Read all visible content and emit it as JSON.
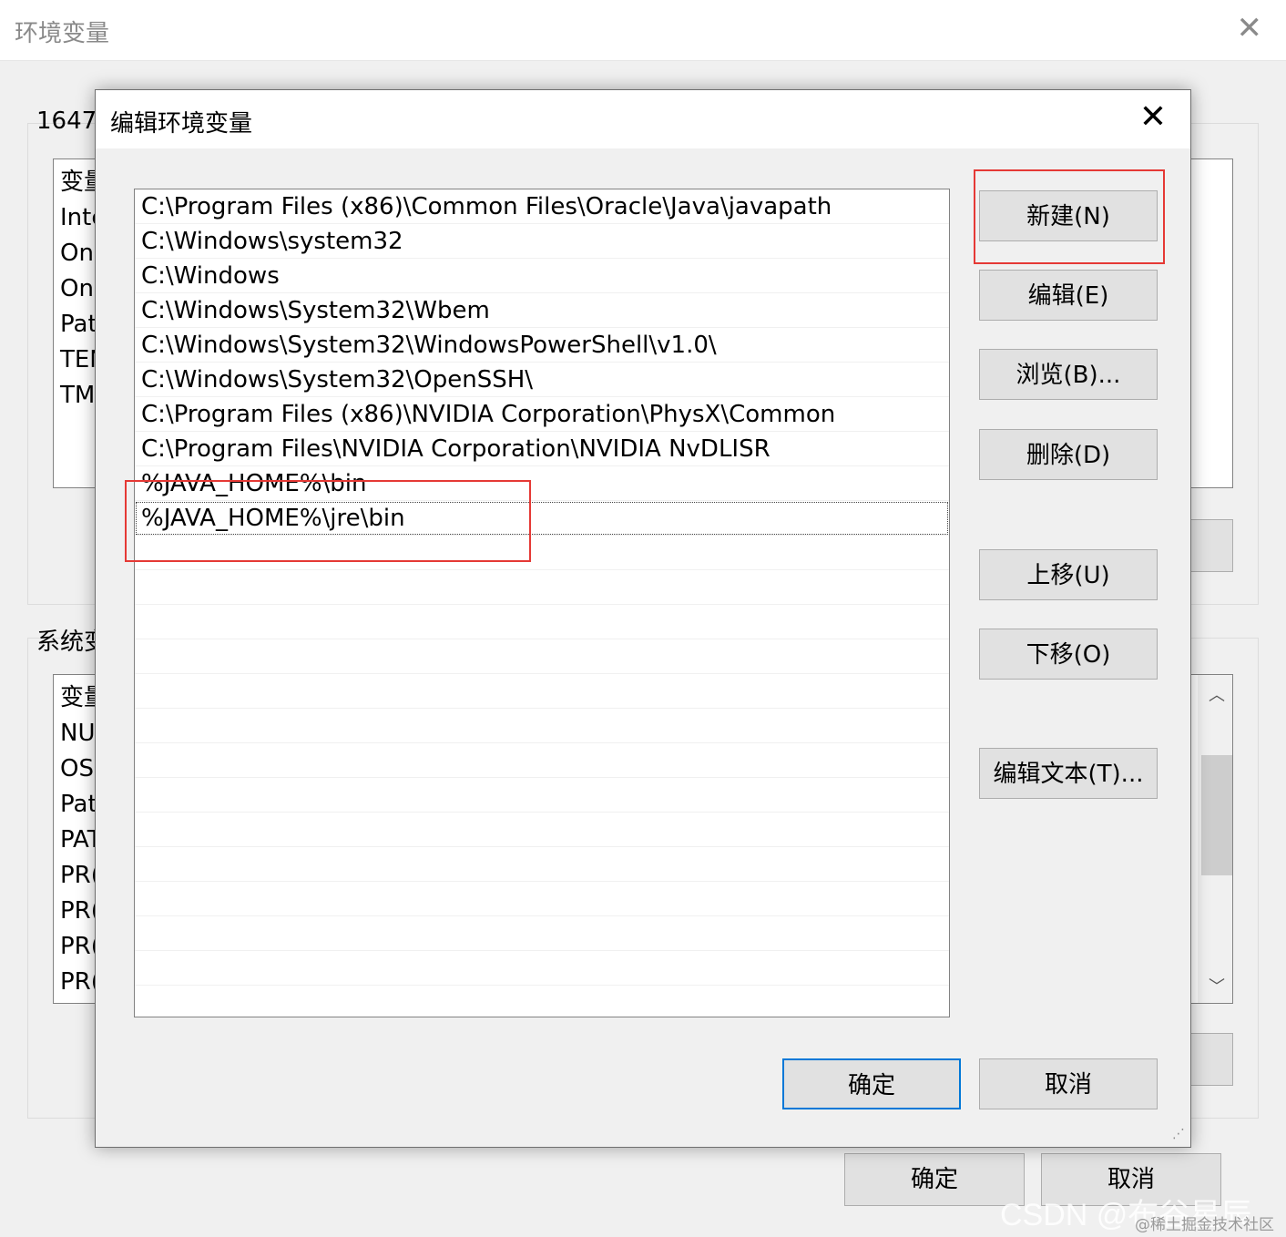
{
  "background_window": {
    "title": "环境变量",
    "user_section_label": "1647",
    "user_header": "变量",
    "user_rows": [
      "Inte",
      "On",
      "On",
      "Pat",
      "TEN",
      "TM"
    ],
    "system_section_label": "系统变",
    "system_header": "变量",
    "system_rows": [
      "NU",
      "OS",
      "Pat",
      "PAT",
      "PR(",
      "PR(",
      "PR(",
      "PR("
    ],
    "ok_label": "确定",
    "cancel_label": "取消",
    "scroll_up": "^",
    "scroll_down": "v"
  },
  "dialog": {
    "title": "编辑环境变量",
    "paths": [
      "C:\\Program Files (x86)\\Common Files\\Oracle\\Java\\javapath",
      "C:\\Windows\\system32",
      "C:\\Windows",
      "C:\\Windows\\System32\\Wbem",
      "C:\\Windows\\System32\\WindowsPowerShell\\v1.0\\",
      "C:\\Windows\\System32\\OpenSSH\\",
      "C:\\Program Files (x86)\\NVIDIA Corporation\\PhysX\\Common",
      "C:\\Program Files\\NVIDIA Corporation\\NVIDIA NvDLISR",
      "%JAVA_HOME%\\bin",
      "%JAVA_HOME%\\jre\\bin"
    ],
    "buttons": {
      "new": "新建(N)",
      "edit": "编辑(E)",
      "browse": "浏览(B)...",
      "delete": "删除(D)",
      "move_up": "上移(U)",
      "move_down": "下移(O)",
      "edit_text": "编辑文本(T)..."
    },
    "ok_label": "确定",
    "cancel_label": "取消"
  },
  "watermark": "CSDN @布谷星辰",
  "watermark_sub": "@稀土掘金技术社区",
  "colors": {
    "highlight": "#e53935",
    "primary_border": "#0078d7"
  }
}
